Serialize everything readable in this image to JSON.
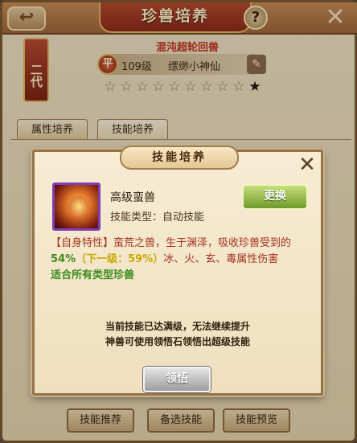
{
  "header": {
    "back_icon": "back-arrow-icon",
    "title": "珍兽培养",
    "help_label": "?",
    "close_label": "✕"
  },
  "pet": {
    "generation": "二代",
    "subtitle": "混沌超轮回兽",
    "rank_badge": "平",
    "level": "109级",
    "name": "缥缈小神仙",
    "rename_icon": "pen-icon",
    "stars_total": 10,
    "stars_filled": 1
  },
  "tabs": [
    {
      "label": "属性培养",
      "active": false
    },
    {
      "label": "技能培养",
      "active": true
    }
  ],
  "bottom_buttons": [
    {
      "label": "技能推荐"
    },
    {
      "label": "备选技能"
    },
    {
      "label": "技能预览"
    }
  ],
  "modal": {
    "title": "技能培养",
    "close_label": "✕",
    "skill": {
      "icon": "beast-skill-icon",
      "name": "高级蛮兽",
      "type": "技能类型：自动技能"
    },
    "change_button": "更换",
    "description": {
      "line1": "【自身特性】蛮荒之兽，生于渊泽，吸收珍兽受到的",
      "pct_current": "54%",
      "pct_next": "（下一级：59%）",
      "line2_rest": "冰、火、玄、毒属性伤害",
      "applicable": "适合所有类型珍兽"
    },
    "notice": {
      "line1": "当前技能已达满级，无法继续提升",
      "line2": "神兽可使用领悟石领悟出超级技能"
    },
    "comprehend_button": "领悟"
  },
  "colors": {
    "accent_red": "#a3321e",
    "accent_green": "#3a8c1c",
    "accent_gold": "#c9a800"
  }
}
